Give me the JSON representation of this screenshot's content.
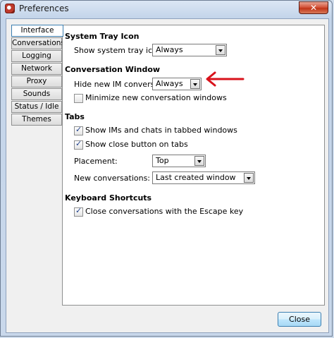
{
  "window": {
    "title": "Preferences",
    "close_glyph": "✕"
  },
  "tabs": [
    {
      "label": "Interface",
      "active": true
    },
    {
      "label": "Conversations",
      "active": false
    },
    {
      "label": "Logging",
      "active": false
    },
    {
      "label": "Network",
      "active": false
    },
    {
      "label": "Proxy",
      "active": false
    },
    {
      "label": "Sounds",
      "active": false
    },
    {
      "label": "Status / Idle",
      "active": false
    },
    {
      "label": "Themes",
      "active": false
    }
  ],
  "system_tray": {
    "heading": "System Tray Icon",
    "show_label": "Show system tray icon:",
    "show_value": "Always"
  },
  "conversation_window": {
    "heading": "Conversation Window",
    "hide_label": "Hide new IM conversations:",
    "hide_value": "Always",
    "minimize_label": "Minimize new conversation windows",
    "minimize_checked": false
  },
  "tabs_section": {
    "heading": "Tabs",
    "show_ims_label": "Show IMs and chats in tabbed windows",
    "show_ims_checked": true,
    "show_close_label": "Show close button on tabs",
    "show_close_checked": true,
    "placement_label": "Placement:",
    "placement_value": "Top",
    "new_conv_label": "New conversations:",
    "new_conv_value": "Last created window"
  },
  "keyboard": {
    "heading": "Keyboard Shortcuts",
    "escape_label": "Close conversations with the Escape key",
    "escape_checked": true
  },
  "footer": {
    "close_label": "Close"
  },
  "annotation": {
    "arrow_color": "#d9121b"
  }
}
